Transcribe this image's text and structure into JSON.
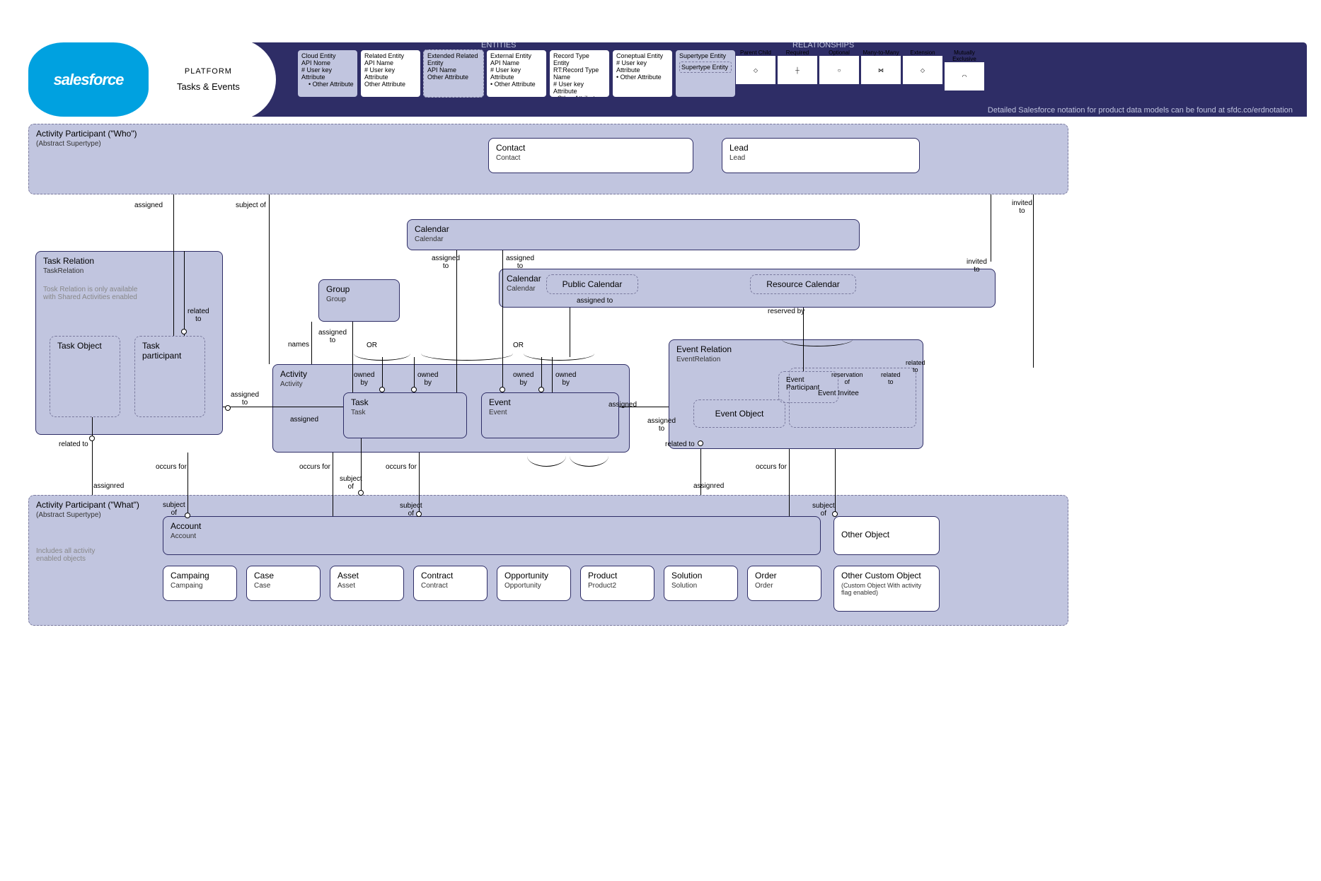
{
  "header": {
    "logo_text": "salesforce",
    "platform_label": "PLATFORM",
    "subtitle": "Tasks & Events",
    "entities_label": "ENTITIES",
    "relationships_label": "RELATIONSHIPS",
    "footer_note": "Detailed  Salesforce notation for product data models can be found at sfdc.co/erdnotation"
  },
  "legend_entities": [
    {
      "title": "Cloud Entity",
      "line1": "API Nome",
      "line2": "# User key Attribute",
      "line3": "• Other Attribute"
    },
    {
      "title": "Related Entity",
      "line1": "API Name",
      "line2": "# User key Attribute",
      "line3": "Other Attribute"
    },
    {
      "title": "Extended Related Entity",
      "line1": "API Name",
      "line2": "Other Attribute",
      "line3": ""
    },
    {
      "title": "External Entity",
      "line1": "API Name",
      "line2": "# User key Attribute",
      "line3": "• Other Attribute"
    },
    {
      "title": "Record Type Entity",
      "line1": "RT:Record Type Name",
      "line2": "# User key Attribute",
      "line3": "• Other Attribute"
    },
    {
      "title": "Coneptual Entity",
      "line1": "",
      "line2": "# User key Attribute",
      "line3": "• Other Attribute"
    },
    {
      "title": "Supertype Entity",
      "line1": "Supertype Entity",
      "line2": "",
      "line3": ""
    }
  ],
  "legend_relationships": [
    {
      "label": "Parent Child"
    },
    {
      "label": "Required"
    },
    {
      "label": "Optional"
    },
    {
      "label": "Many-to-Many"
    },
    {
      "label": "Extension"
    },
    {
      "label": "Mutually Exclusive"
    }
  ],
  "supertypes": {
    "who": {
      "title": "Activity Participant (\"Who\")",
      "sub": "(Abstract Supertype)"
    },
    "what": {
      "title": "Activity Participant (\"What\")",
      "sub": "(Abstract Supertype)",
      "note": "Includes all activity enabled objects"
    }
  },
  "entities": {
    "contact": {
      "title": "Contact",
      "sub": "Contact"
    },
    "lead": {
      "title": "Lead",
      "sub": "Lead"
    },
    "task_relation": {
      "title": "Task Relation",
      "sub": "TaskRelation",
      "note": "Tosk Relation is only available with Shared Activities enabled"
    },
    "task_object": {
      "title": "Task Object"
    },
    "task_participant": {
      "title": "Task participant"
    },
    "calendar": {
      "title": "Calendar",
      "sub": "Calendar"
    },
    "calendar2": {
      "title": "Calendar",
      "sub": "Calendar"
    },
    "public_calendar": {
      "title": "Public Calendar"
    },
    "resource_calendar": {
      "title": "Resource Calendar"
    },
    "group": {
      "title": "Group",
      "sub": "Group"
    },
    "activity": {
      "title": "Activity",
      "sub": "Activity"
    },
    "task": {
      "title": "Task",
      "sub": "Task"
    },
    "event": {
      "title": "Event",
      "sub": "Event"
    },
    "event_relation": {
      "title": "Event Relation",
      "sub": "EventRelation"
    },
    "event_object": {
      "title": "Event Object"
    },
    "event_participant": {
      "title": "Event Participant"
    },
    "event_invitee": {
      "title": "Event Invitee"
    },
    "account": {
      "title": "Account",
      "sub": "Account"
    },
    "other_object": {
      "title": "Other Object"
    },
    "other_custom": {
      "title": "Other Custom Object",
      "sub": "(Custom Object With activity flag enabled)"
    },
    "campaign": {
      "title": "Campaing",
      "sub": "Campaing"
    },
    "case": {
      "title": "Case",
      "sub": "Case"
    },
    "asset": {
      "title": "Asset",
      "sub": "Asset"
    },
    "contract": {
      "title": "Contract",
      "sub": "Contract"
    },
    "opportunity": {
      "title": "Opportunity",
      "sub": "Opportunity"
    },
    "product": {
      "title": "Product",
      "sub": "Product2"
    },
    "solution": {
      "title": "Solution",
      "sub": "Solution"
    },
    "order": {
      "title": "Order",
      "sub": "Order"
    }
  },
  "labels": {
    "assigned": "assigned",
    "subject_of": "subject of",
    "invited_to": "invited to",
    "related_to": "related to",
    "assigned_to": "assigned to",
    "names": "names",
    "owned_by": "owned by",
    "occurs_for": "occurs for",
    "assignred": "assignred",
    "reserved_by": "reserved by",
    "reservation_of": "reservation of",
    "or": "OR"
  }
}
